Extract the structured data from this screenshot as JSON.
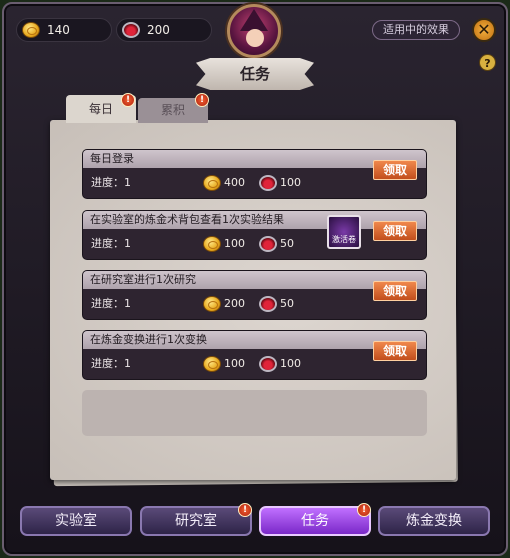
{
  "currency": {
    "gold": "140",
    "potion": "200"
  },
  "header": {
    "effects_label": "适用中的效果",
    "close_label": "✕",
    "help_label": "?",
    "title": "任务"
  },
  "tabs": [
    {
      "label": "每日",
      "badge": "!"
    },
    {
      "label": "累积",
      "badge": "!"
    }
  ],
  "tasks": [
    {
      "title": "每日登录",
      "progress": "进度：1",
      "gold": "400",
      "potion": "100",
      "claim": "领取",
      "item": ""
    },
    {
      "title": "在实验室的炼金术背包查看1次实验结果",
      "progress": "进度：1",
      "gold": "100",
      "potion": "50",
      "claim": "领取",
      "item": "激活卷"
    },
    {
      "title": "在研究室进行1次研究",
      "progress": "进度：1",
      "gold": "200",
      "potion": "50",
      "claim": "领取",
      "item": ""
    },
    {
      "title": "在炼金变换进行1次变换",
      "progress": "进度：1",
      "gold": "100",
      "potion": "100",
      "claim": "领取",
      "item": ""
    }
  ],
  "nav": [
    {
      "label": "实验室",
      "badge": ""
    },
    {
      "label": "研究室",
      "badge": "!"
    },
    {
      "label": "任务",
      "badge": "!"
    },
    {
      "label": "炼金变换",
      "badge": ""
    }
  ]
}
